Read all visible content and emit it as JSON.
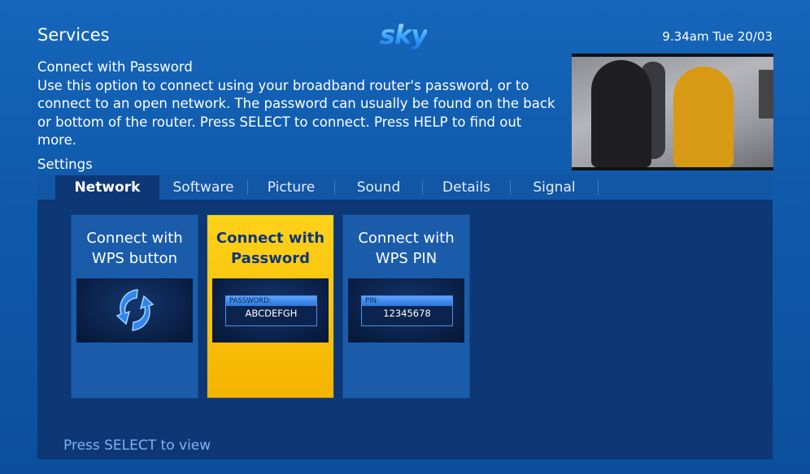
{
  "header": {
    "title": "Services",
    "logo": "sky",
    "clock": "9.34am Tue 20/03"
  },
  "description": {
    "title": "Connect with Password",
    "body": "Use this option to connect using your broadband router's password, or to connect to an open network. The password can usually be found on the back or bottom of the router. Press SELECT to connect. Press HELP to find out more."
  },
  "settings_label": "Settings",
  "tabs": [
    {
      "label": "Network",
      "active": true
    },
    {
      "label": "Software",
      "active": false
    },
    {
      "label": "Picture",
      "active": false
    },
    {
      "label": "Sound",
      "active": false
    },
    {
      "label": "Details",
      "active": false
    },
    {
      "label": "Signal",
      "active": false
    }
  ],
  "cards": [
    {
      "title_line1": "Connect with",
      "title_line2": "WPS button",
      "icon": "wps-icon",
      "selected": false
    },
    {
      "title_line1": "Connect with",
      "title_line2": "Password",
      "field_label": "PASSWORD:",
      "field_value": "ABCDEFGH",
      "selected": true
    },
    {
      "title_line1": "Connect with",
      "title_line2": "WPS PIN",
      "field_label": "PIN:",
      "field_value": "12345678",
      "selected": false
    }
  ],
  "hint": "Press SELECT to view",
  "colors": {
    "background": "#0f5aab",
    "panel": "#0e3776",
    "selected_card": "#f4b400",
    "card": "#1a5caa"
  }
}
